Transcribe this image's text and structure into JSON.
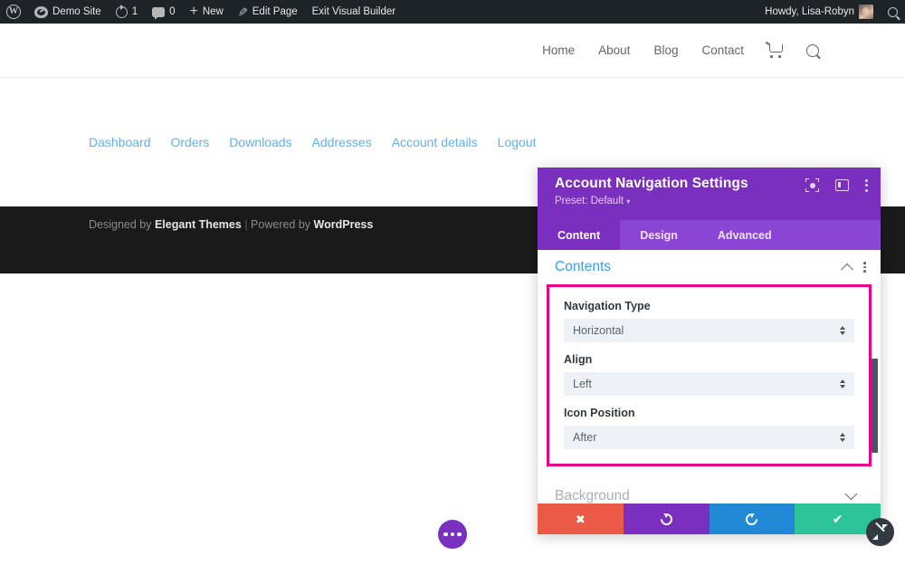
{
  "adminbar": {
    "logo_icon": "wordpress-logo-icon",
    "site_name": "Demo Site",
    "site_icon": "dashboard-icon",
    "updates_icon": "updates-icon",
    "updates_count": "1",
    "comments_icon": "comments-icon",
    "comments_count": "0",
    "new_icon": "plus-icon",
    "new_label": "New",
    "edit_icon": "pencil-icon",
    "edit_label": "Edit Page",
    "exit_label": "Exit Visual Builder",
    "howdy": "Howdy, Lisa-Robyn",
    "avatar_icon": "avatar",
    "search_icon": "search-icon"
  },
  "site_header": {
    "nav": [
      {
        "label": "Home"
      },
      {
        "label": "About"
      },
      {
        "label": "Blog"
      },
      {
        "label": "Contact"
      }
    ],
    "cart_icon": "cart-icon",
    "search_icon": "search-icon"
  },
  "account_nav": {
    "links": [
      {
        "label": "Dashboard"
      },
      {
        "label": "Orders"
      },
      {
        "label": "Downloads"
      },
      {
        "label": "Addresses"
      },
      {
        "label": "Account details"
      },
      {
        "label": "Logout"
      }
    ],
    "link_color": "#5cb3f0"
  },
  "footer": {
    "prefix": "Designed by ",
    "brand1": "Elegant Themes",
    "separator": " | ",
    "middle": "Powered by ",
    "brand2": "WordPress",
    "background": "#1a1a1a"
  },
  "fab": {
    "icon": "ellipsis-icon",
    "color": "#7b2fbe"
  },
  "modal": {
    "title": "Account Navigation Settings",
    "preset_label": "Preset: Default",
    "preset_caret": "▾",
    "header_color": "#7b2fbe",
    "header_icons": [
      {
        "name": "focus-target-icon"
      },
      {
        "name": "layout-panel-icon"
      },
      {
        "name": "more-vertical-icon"
      }
    ],
    "tabs": [
      {
        "label": "Content",
        "active": true
      },
      {
        "label": "Design",
        "active": false
      },
      {
        "label": "Advanced",
        "active": false
      }
    ],
    "sections": [
      {
        "title": "Contents",
        "expanded": true
      },
      {
        "title": "Background",
        "expanded": false
      }
    ],
    "highlight_color": "#ec008c",
    "fields": [
      {
        "label": "Navigation Type",
        "value": "Horizontal"
      },
      {
        "label": "Align",
        "value": "Left"
      },
      {
        "label": "Icon Position",
        "value": "After"
      }
    ],
    "footer_buttons": [
      {
        "name": "cancel-button",
        "icon": "close-icon",
        "color": "#ea5a47"
      },
      {
        "name": "undo-button",
        "icon": "undo-icon",
        "color": "#7b2fbe"
      },
      {
        "name": "redo-button",
        "icon": "redo-icon",
        "color": "#2088d4"
      },
      {
        "name": "save-button",
        "icon": "check-icon",
        "color": "#2ec49a"
      }
    ],
    "resize_handle_icon": "resize-diagonal-icon"
  }
}
